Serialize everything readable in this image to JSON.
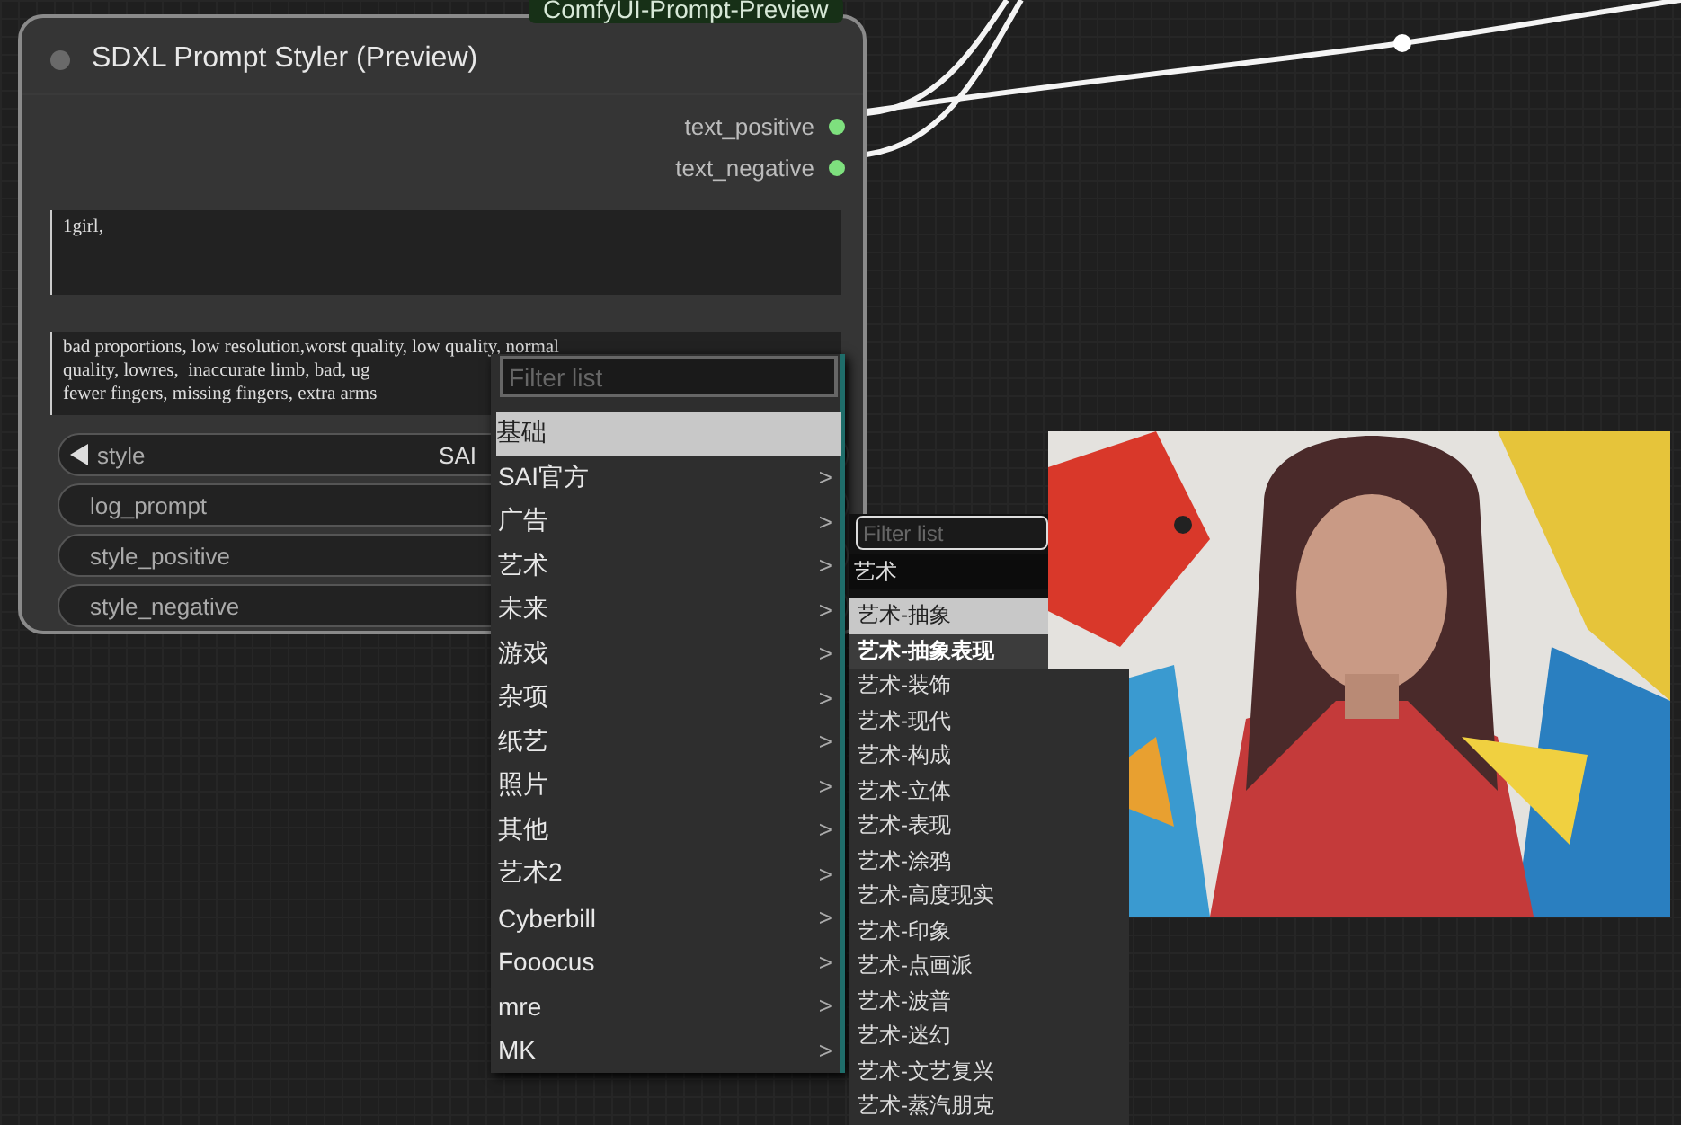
{
  "node": {
    "badge": "ComfyUI-Prompt-Preview",
    "title": "SDXL Prompt Styler (Preview)",
    "outputs": [
      {
        "label": "text_positive",
        "color": "#7ee07e"
      },
      {
        "label": "text_negative",
        "color": "#7ee07e"
      }
    ],
    "positive_prompt": "1girl,",
    "negative_prompt_lines": [
      "bad proportions, low resolution,worst quality, low quality, normal",
      "quality, lowres,  inaccurate limb, bad, ug",
      "fewer fingers, missing fingers, extra arms"
    ],
    "widgets": [
      {
        "kind": "combo",
        "label": "style",
        "value": "SAI"
      },
      {
        "kind": "plain",
        "label": "log_prompt"
      },
      {
        "kind": "plain",
        "label": "style_positive"
      },
      {
        "kind": "plain",
        "label": "style_negative"
      }
    ]
  },
  "menu": {
    "placeholder": "Filter list",
    "items": [
      {
        "label": "基础",
        "selected": true
      },
      {
        "label": "SAI官方",
        "selected": false,
        "arrow": ">"
      },
      {
        "label": "广告",
        "selected": false,
        "arrow": ">"
      },
      {
        "label": "艺术",
        "selected": false,
        "arrow": ">"
      },
      {
        "label": "未来",
        "selected": false,
        "arrow": ">"
      },
      {
        "label": "游戏",
        "selected": false,
        "arrow": ">"
      },
      {
        "label": "杂项",
        "selected": false,
        "arrow": ">"
      },
      {
        "label": "纸艺",
        "selected": false,
        "arrow": ">"
      },
      {
        "label": "照片",
        "selected": false,
        "arrow": ">"
      },
      {
        "label": "其他",
        "selected": false,
        "arrow": ">"
      },
      {
        "label": "艺术2",
        "selected": false,
        "arrow": ">"
      },
      {
        "label": "Cyberbill",
        "selected": false,
        "arrow": ">"
      },
      {
        "label": "Fooocus",
        "selected": false,
        "arrow": ">"
      },
      {
        "label": "mre",
        "selected": false,
        "arrow": ">"
      },
      {
        "label": "MK",
        "selected": false,
        "arrow": ">"
      }
    ]
  },
  "submenu": {
    "placeholder": "Filter list",
    "header": "艺术",
    "items": [
      {
        "label": "艺术-抽象",
        "selected": true,
        "hovered": false
      },
      {
        "label": "艺术-抽象表现",
        "selected": false,
        "hovered": true
      },
      {
        "label": "艺术-装饰",
        "selected": false,
        "hovered": false
      },
      {
        "label": "艺术-现代",
        "selected": false,
        "hovered": false
      },
      {
        "label": "艺术-构成",
        "selected": false,
        "hovered": false
      },
      {
        "label": "艺术-立体",
        "selected": false,
        "hovered": false
      },
      {
        "label": "艺术-表现",
        "selected": false,
        "hovered": false
      },
      {
        "label": "艺术-涂鸦",
        "selected": false,
        "hovered": false
      },
      {
        "label": "艺术-高度现实",
        "selected": false,
        "hovered": false
      },
      {
        "label": "艺术-印象",
        "selected": false,
        "hovered": false
      },
      {
        "label": "艺术-点画派",
        "selected": false,
        "hovered": false
      },
      {
        "label": "艺术-波普",
        "selected": false,
        "hovered": false
      },
      {
        "label": "艺术-迷幻",
        "selected": false,
        "hovered": false
      },
      {
        "label": "艺术-文艺复兴",
        "selected": false,
        "hovered": false
      },
      {
        "label": "艺术-蒸汽朋克",
        "selected": false,
        "hovered": false
      }
    ]
  }
}
